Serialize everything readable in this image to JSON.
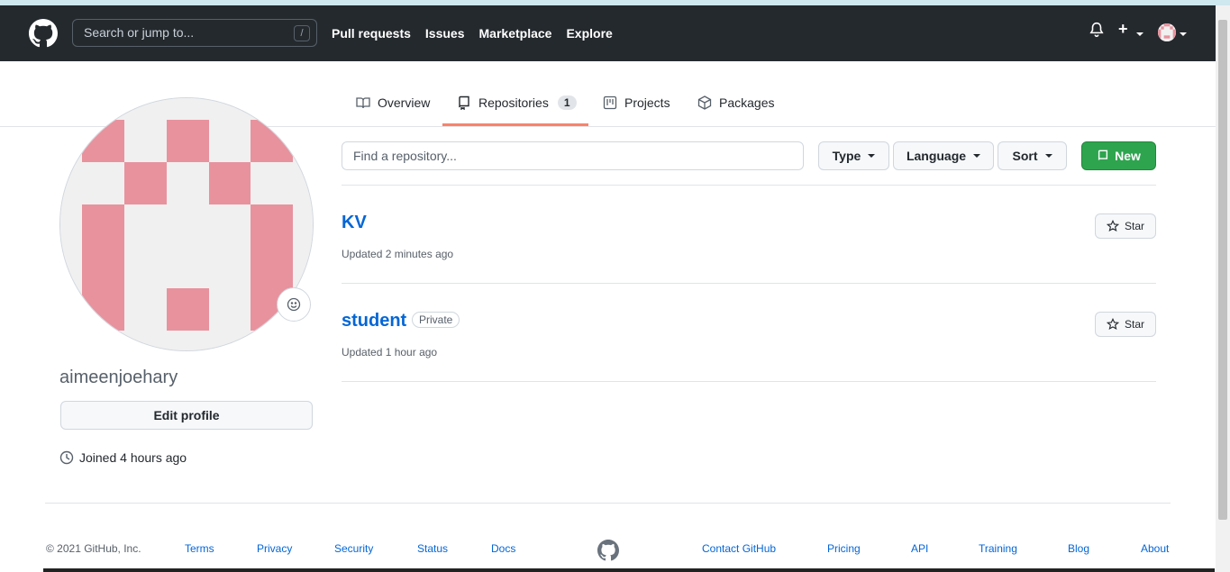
{
  "header": {
    "search_placeholder": "Search or jump to...",
    "search_shortcut": "/",
    "nav": [
      "Pull requests",
      "Issues",
      "Marketplace",
      "Explore"
    ],
    "plus_label": "+"
  },
  "tabs": [
    {
      "label": "Overview",
      "icon": "book-icon"
    },
    {
      "label": "Repositories",
      "icon": "repo-icon",
      "count": "1",
      "active": true
    },
    {
      "label": "Projects",
      "icon": "project-icon"
    },
    {
      "label": "Packages",
      "icon": "package-icon"
    }
  ],
  "profile": {
    "username": "aimeenjoehary",
    "edit_label": "Edit profile",
    "joined": "Joined 4 hours ago"
  },
  "filters": {
    "find_placeholder": "Find a repository...",
    "type_label": "Type",
    "language_label": "Language",
    "sort_label": "Sort",
    "new_label": "New"
  },
  "repos": [
    {
      "name": "KV",
      "updated": "Updated 2 minutes ago",
      "star_label": "Star"
    },
    {
      "name": "student",
      "badge": "Private",
      "updated": "Updated 1 hour ago",
      "star_label": "Star"
    }
  ],
  "footer": {
    "copyright": "© 2021 GitHub, Inc.",
    "left_links": [
      "Terms",
      "Privacy",
      "Security",
      "Status",
      "Docs"
    ],
    "right_links": [
      "Contact GitHub",
      "Pricing",
      "API",
      "Training",
      "Blog",
      "About"
    ]
  },
  "colors": {
    "header_bg": "#24292e",
    "accent_tab": "#f9826c",
    "link": "#0366d6",
    "new_button": "#2ea44f",
    "avatar_pink": "#e8929e"
  }
}
